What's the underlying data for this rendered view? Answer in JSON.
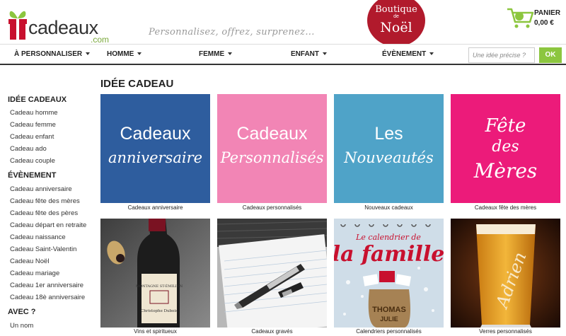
{
  "header": {
    "logo_text": "cadeaux",
    "logo_domain": ".com",
    "tagline": "Personnalisez, offrez, surprenez...",
    "noel": {
      "line1": "Boutique",
      "line2": "de",
      "line3": "Noël"
    },
    "cart": {
      "count": "0",
      "label": "PANIER",
      "total": "0,00 €"
    }
  },
  "nav": {
    "items": [
      "À PERSONNALISER",
      "HOMME",
      "FEMME",
      "ENFANT",
      "ÉVÈNEMENT"
    ],
    "search_placeholder": "Une idée précise ?",
    "ok_label": "OK"
  },
  "sidebar": {
    "sections": [
      {
        "title": "IDÉE CADEAUX",
        "links": [
          "Cadeau homme",
          "Cadeau femme",
          "Cadeau enfant",
          "Cadeau ado",
          "Cadeau couple"
        ]
      },
      {
        "title": "ÉVÈNEMENT",
        "links": [
          "Cadeau anniversaire",
          "Cadeau fête des mères",
          "Cadeau fête des pères",
          "Cadeau départ en retraite",
          "Cadeau naissance",
          "Cadeau Saint-Valentin",
          "Cadeau Noël",
          "Cadeau mariage",
          "Cadeau 1er anniversaire",
          "Cadeau 18è anniversaire"
        ]
      },
      {
        "title": "AVEC ?",
        "links": [
          "Un nom"
        ]
      }
    ]
  },
  "main": {
    "title": "IDÉE CADEAU",
    "category_tiles": [
      {
        "line1": "Cadeaux",
        "line2": "anniversaire",
        "caption": "Cadeaux anniversaire",
        "color": "#2e5d9e"
      },
      {
        "line1": "Cadeaux",
        "line2": "Personnalisés",
        "caption": "Cadeaux personnalisés",
        "color": "#f285b5"
      },
      {
        "line1": "Les",
        "line2": "Nouveautés",
        "caption": "Nouveaux cadeaux",
        "color": "#4fa3c8"
      },
      {
        "line1": "Fête",
        "line2": "des",
        "line3": "Mères",
        "caption": "Cadeaux fête des mères",
        "color": "#ec1b7a"
      }
    ],
    "photo_tiles": [
      {
        "caption": "Vins et spiritueux",
        "label_text": "Christophe Dubois"
      },
      {
        "caption": "Cadeaux gravés"
      },
      {
        "caption": "Calendriers personnalisés",
        "line1": "Le calendrier de",
        "line2": "la famille",
        "name1": "THOMAS",
        "name2": "JULIE"
      },
      {
        "caption": "Verres personnalisés",
        "engraving": "Adrien"
      }
    ]
  }
}
